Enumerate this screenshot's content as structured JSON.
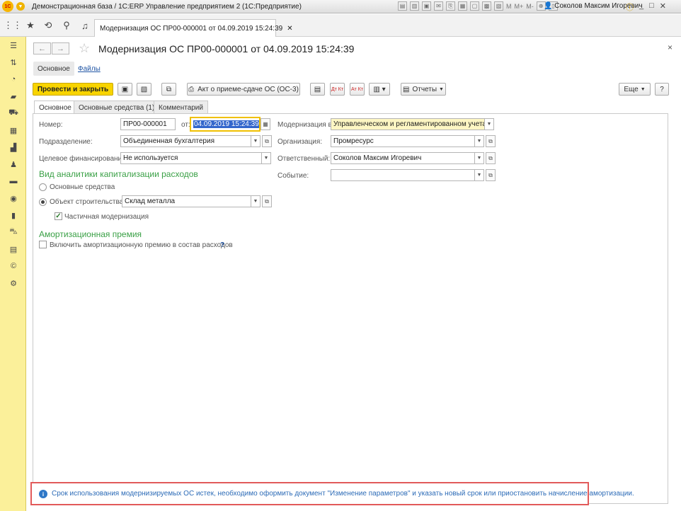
{
  "titlebar": {
    "logo": "1С",
    "title": "Демонстрационная база / 1С:ERP Управление предприятием 2  (1С:Предприятие)",
    "m_labels": [
      "M",
      "M+",
      "M-"
    ],
    "user": "Соколов Максим Игоревич",
    "win_controls": [
      "_",
      "□",
      "✕"
    ]
  },
  "navbar": {
    "icons": [
      "apps-icon",
      "star-icon",
      "history-icon",
      "search-icon",
      "bell-icon"
    ]
  },
  "doc_tab": {
    "label": "Модернизация ОС ПР00-000001 от 04.09.2019 15:24:39",
    "close": "✕"
  },
  "form": {
    "title": "Модернизация ОС ПР00-000001 от 04.09.2019 15:24:39",
    "close": "×",
    "subtabs": {
      "main": "Основное",
      "files": "Файлы"
    },
    "toolbar": {
      "post_close": "Провести и закрыть",
      "act": "Акт о приеме-сдаче ОС (ОС-3)",
      "reports": "Отчеты",
      "more": "Еще",
      "help": "?",
      "dt_kt": "Дт Кт",
      "at_kt": "Ат Кт"
    },
    "tabs": [
      "Основное",
      "Основные средства (1)",
      "Комментарий"
    ],
    "fields": {
      "number_label": "Номер:",
      "number_value": "ПР00-000001",
      "date_label": "от:",
      "date_value": "04.09.2019 15:24:39",
      "modernization_label": "Модернизация в:",
      "modernization_value": "Управленческом и регламентированном учетах",
      "division_label": "Подразделение:",
      "division_value": "Объединенная бухгалтерия",
      "organization_label": "Организация:",
      "organization_value": "Промресурс",
      "financing_label": "Целевое финансирование:",
      "financing_value": "Не используется",
      "responsible_label": "Ответственный:",
      "responsible_value": "Соколов Максим Игоревич",
      "event_label": "Событие:",
      "event_value": ""
    },
    "capitalization": {
      "title": "Вид аналитики капитализации расходов",
      "option_fixed_assets": "Основные средства",
      "option_construction": "Объект строительства:",
      "construction_value": "Склад металла",
      "partial": "Частичная модернизация"
    },
    "bonus": {
      "title": "Амортизационная премия",
      "include": "Включить амортизационную премию в состав расходов",
      "help": "?"
    }
  },
  "info": {
    "icon": "i",
    "text": "Срок использования модернизируемых ОС истек, необходимо оформить документ \"Изменение параметров\" и указать новый срок или приостановить начисление амортизации."
  },
  "colors": {
    "sidebar": "#fbf09a",
    "primary_button": "#f8d400",
    "section_title": "#3aa046",
    "link": "#2156a5",
    "info_border": "#e25a5a"
  }
}
